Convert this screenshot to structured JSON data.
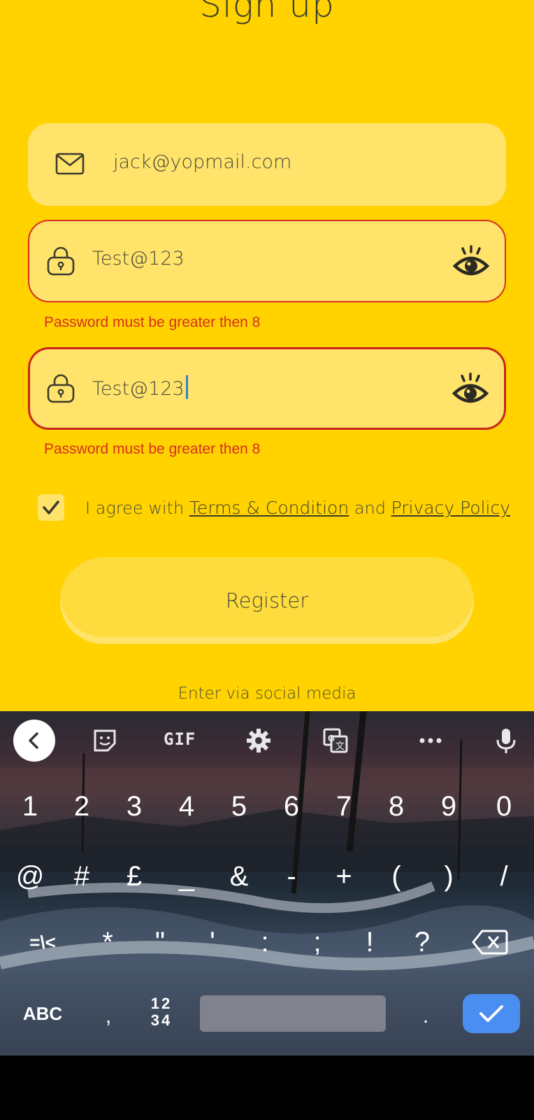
{
  "screen": {
    "title": "Sign up"
  },
  "form": {
    "email": {
      "value": "jack@yopmail.com",
      "icon": "envelope-icon"
    },
    "password": {
      "value": "Test@123",
      "icon": "lock-icon",
      "toggle_icon": "eye-icon",
      "error": "Password must be greater then 8"
    },
    "confirm_password": {
      "value": "Test@123",
      "icon": "lock-icon",
      "toggle_icon": "eye-icon",
      "error": "Password must be greater then 8"
    },
    "agree": {
      "checked": true,
      "prefix": "I agree with",
      "terms_link": "Terms & Condition",
      "conjunction": "and",
      "privacy_link": "Privacy Policy"
    },
    "register_label": "Register",
    "social_label": "Enter via social media"
  },
  "keyboard": {
    "toolbar": [
      "back-icon",
      "sticker-icon",
      "GIF",
      "settings-icon",
      "translate-icon",
      "more-icon",
      "microphone-icon"
    ],
    "gif_label": "GIF",
    "row1": [
      "1",
      "2",
      "3",
      "4",
      "5",
      "6",
      "7",
      "8",
      "9",
      "0"
    ],
    "row2": [
      "@",
      "#",
      "£",
      "_",
      "&",
      "-",
      "+",
      "(",
      ")",
      "/"
    ],
    "row3": [
      "=\\<",
      "*",
      "\"",
      "'",
      ":",
      ";",
      "!",
      "?"
    ],
    "row4": {
      "abc": "ABC",
      "comma": ",",
      "numpad_top": "12",
      "numpad_bottom": "34",
      "period": "."
    }
  },
  "colors": {
    "background": "#FFD200",
    "field": "#FFE36B",
    "error": "#D7301D",
    "caret": "#2F7FD6",
    "enter_key": "#4B8EF1"
  }
}
